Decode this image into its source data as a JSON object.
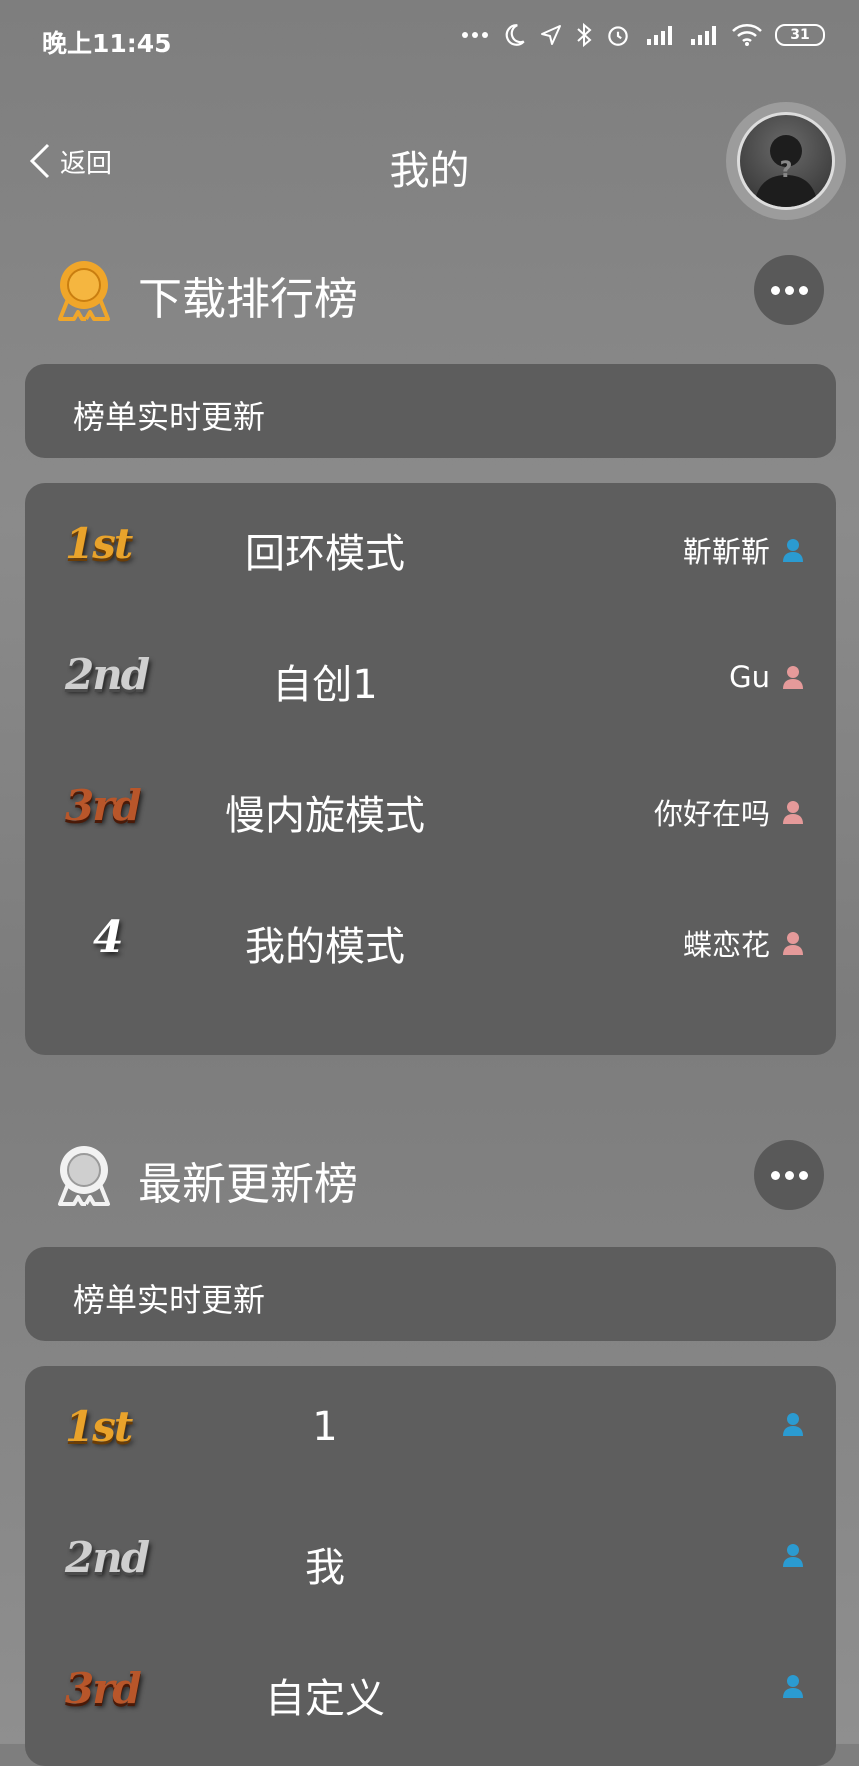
{
  "status_bar": {
    "time": "晚上11:45",
    "battery": "31"
  },
  "nav": {
    "back_label": "返回",
    "title": "我的"
  },
  "download_rank": {
    "title": "下载排行榜",
    "info": "榜单实时更新",
    "rows": [
      {
        "rank": "1st",
        "name": "回环模式",
        "author": "靳靳靳",
        "gender": "male"
      },
      {
        "rank": "2nd",
        "name": "自创1",
        "author": "Gu",
        "gender": "female"
      },
      {
        "rank": "3rd",
        "name": "慢内旋模式",
        "author": "你好在吗",
        "gender": "female"
      },
      {
        "rank": "4",
        "name": "我的模式",
        "author": "蝶恋花",
        "gender": "female"
      }
    ]
  },
  "latest_rank": {
    "title": "最新更新榜",
    "info": "榜单实时更新",
    "rows": [
      {
        "rank": "1st",
        "name": "1",
        "author": "",
        "gender": "male"
      },
      {
        "rank": "2nd",
        "name": "我",
        "author": "",
        "gender": "male"
      },
      {
        "rank": "3rd",
        "name": "自定义",
        "author": "",
        "gender": "male"
      }
    ]
  },
  "colors": {
    "male_icon": "#2b9bd1",
    "female_icon": "#e59a9a",
    "gold_medal": "#f0a62a",
    "silver_medal": "#f2f2f2"
  },
  "icons": {
    "back": "chevron-left-icon",
    "more": "more-dots-icon",
    "user": "user-icon",
    "medal": "medal-icon"
  }
}
